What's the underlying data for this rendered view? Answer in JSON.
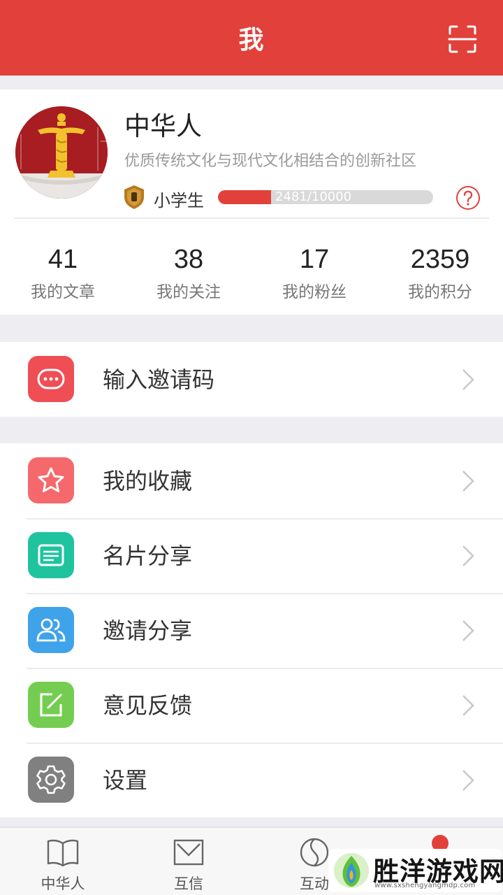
{
  "header": {
    "title": "我",
    "scan_icon": "scan-icon"
  },
  "profile": {
    "name": "中华人",
    "motto": "优质传统文化与现代文化相结合的创新社区",
    "rank": "小学生",
    "progress_text": "2481/10000",
    "progress_fraction": 0.2481,
    "help_icon": "question-circle-icon"
  },
  "stats": [
    {
      "value": "41",
      "label": "我的文章"
    },
    {
      "value": "38",
      "label": "我的关注"
    },
    {
      "value": "17",
      "label": "我的粉丝"
    },
    {
      "value": "2359",
      "label": "我的积分"
    }
  ],
  "menu": {
    "invite_code": {
      "label": "输入邀请码",
      "icon": "chat-bubble-icon",
      "color": "#ef4e55"
    },
    "items": [
      {
        "label": "我的收藏",
        "icon": "star-icon",
        "color": "#f5686b"
      },
      {
        "label": "名片分享",
        "icon": "card-icon",
        "color": "#1fc49f"
      },
      {
        "label": "邀请分享",
        "icon": "users-icon",
        "color": "#3fa3ea"
      },
      {
        "label": "意见反馈",
        "icon": "edit-icon",
        "color": "#74cd50"
      },
      {
        "label": "设置",
        "icon": "gear-icon",
        "color": "#808080"
      }
    ]
  },
  "tabs": [
    {
      "label": "中华人",
      "icon": "book-icon"
    },
    {
      "label": "互信",
      "icon": "mail-icon"
    },
    {
      "label": "互动",
      "icon": "yin-yang-icon"
    },
    {
      "label": "",
      "icon": "notification-dot"
    }
  ],
  "watermark": {
    "text": "胜洋游戏网",
    "url": "www.sxshengyangmdp.com"
  },
  "colors": {
    "brand_red": "#e2403a",
    "background": "#eeeef2"
  }
}
